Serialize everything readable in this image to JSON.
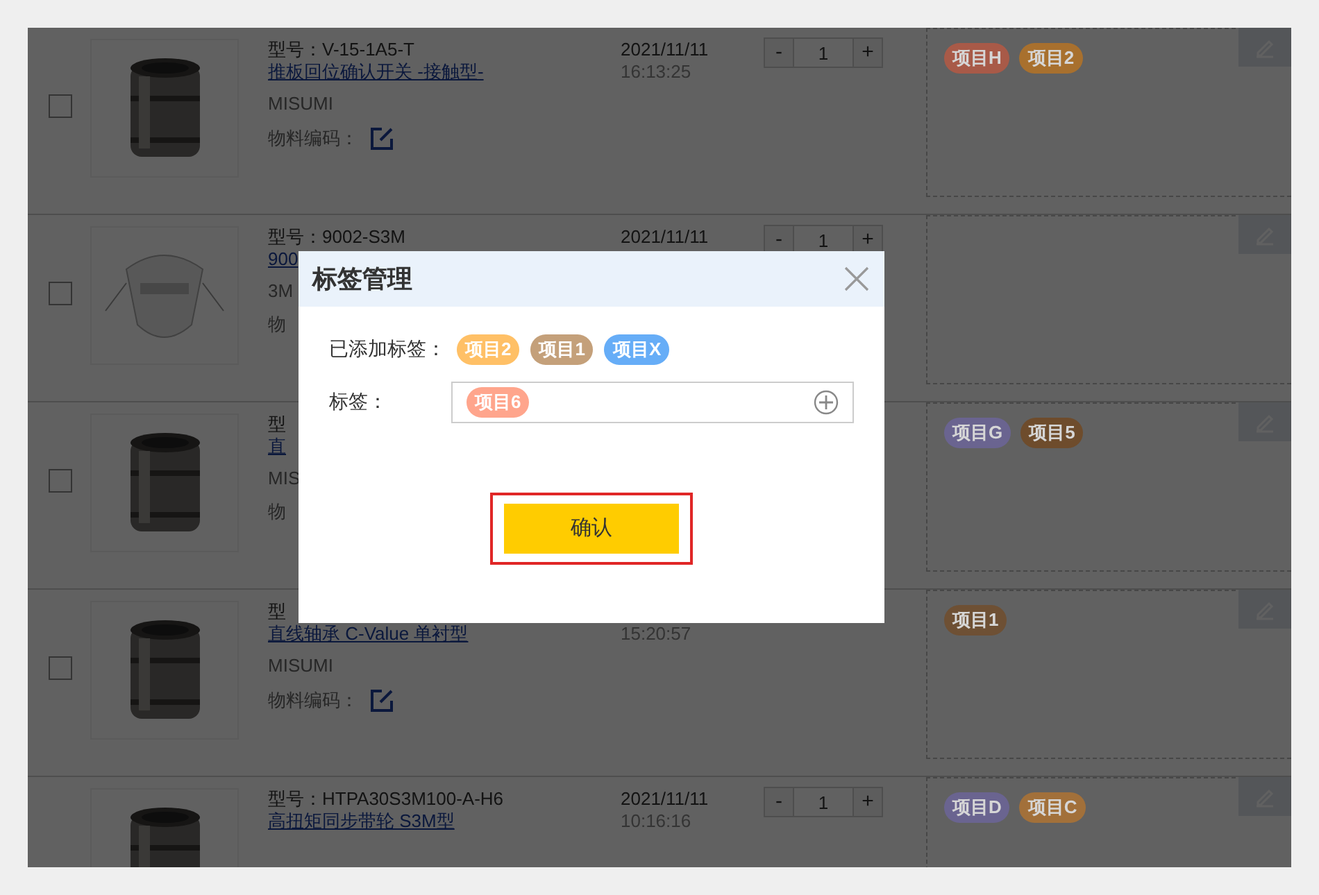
{
  "rows": [
    {
      "checked": false,
      "model": "型号：V-15-1A5-T",
      "name": "推板回位确认开关 -接触型-",
      "brand": "MISUMI",
      "code_label": "物料编码：",
      "code_edit": true,
      "date": "2021/11/11",
      "time": "16:13:25",
      "stepper": {
        "minus": "-",
        "quantity": "1",
        "plus": "+"
      },
      "tags": [
        {
          "label": "项目H",
          "color": "#a85a48"
        },
        {
          "label": "项目2",
          "color": "#a8702e"
        }
      ]
    },
    {
      "checked": false,
      "model": "型号：9002-S3M",
      "name": "900",
      "brand": "3M",
      "code_label": "物",
      "date": "2021/11/11",
      "stepper": {
        "minus": "-",
        "quantity": "1",
        "plus": "+"
      },
      "tags": []
    },
    {
      "checked": false,
      "model": "型",
      "name": "直",
      "brand": "MIS",
      "code_label": "物",
      "tags": [
        {
          "label": "项目G",
          "color": "#6a6490"
        },
        {
          "label": "项目5",
          "color": "#6e4c2c"
        }
      ]
    },
    {
      "checked": false,
      "model": "型",
      "name": "直线轴承 C-Value 单衬型",
      "brand": "MISUMI",
      "code_label": "物料编码：",
      "code_edit": true,
      "time": "15:20:57",
      "tags": [
        {
          "label": "项目1",
          "color": "#6e5034"
        }
      ]
    },
    {
      "model": "型号：HTPA30S3M100-A-H6",
      "name": "高扭矩同步带轮 S3M型",
      "date": "2021/11/11",
      "time": "10:16:16",
      "stepper": {
        "minus": "-",
        "quantity": "1",
        "plus": "+"
      },
      "tags": [
        {
          "label": "项目D",
          "color": "#6a6490"
        },
        {
          "label": "项目C",
          "color": "#a2703a"
        }
      ]
    }
  ],
  "dialog": {
    "title": "标签管理",
    "added_label": "已添加标签：",
    "added_tags": [
      {
        "label": "项目2",
        "color": "#ffc066"
      },
      {
        "label": "项目1",
        "color": "#c4a07a"
      },
      {
        "label": "项目X",
        "color": "#66adf7"
      }
    ],
    "tag_label": "标签：",
    "field_tags": [
      {
        "label": "项目6",
        "color": "#ffa58c"
      }
    ],
    "confirm": "确认"
  }
}
